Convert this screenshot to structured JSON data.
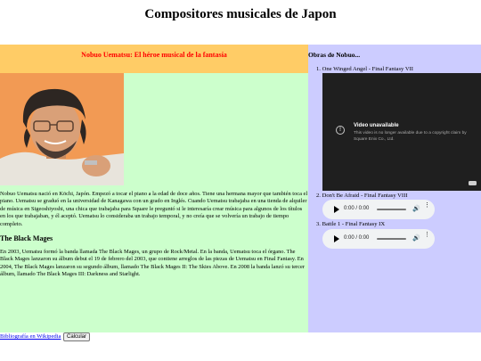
{
  "page": {
    "title": "Compositores musicales de Japon"
  },
  "main": {
    "banner_title": "Nobuo Uematsu: El héroe musical de la fantasía",
    "bio": "Nobuo Uematsu nació en Kōchi, Japón. Empezó a tocar el piano a la edad de doce años. Tiene una hermana mayor que también toca el piano. Uematsu se graduó en la universidad de Kanagawa con un grado en Inglés. Cuando Uematsu trabajaba en una tienda de alquiler de música en Sigeoshiyoshi, una chica que trabajaba para Square le preguntó si le interesaría crear música para algunos de los títulos en los que trabajaban, y él aceptó. Uematsu lo consideraba un trabajo temporal, y no creía que se volvería un trabajo de tiempo completo.",
    "section_heading": "The Black Mages",
    "bio2": "En 2003, Uematsu formó la banda llamada The Black Mages, un grupo de Rock/Metal. En la banda, Uematsu toca el órgano. The Black Mages lanzaron su álbum debut el 19 de febrero del 2003, que contiene arreglos de las piezas de Uematsu en Final Fantasy. En 2004, The Black Mages lanzaron su segundo álbum, llamado The Black Mages II: The Skies Above. En 2008 la banda lanzó su tercer álbum, llamado The Black Mages III: Darkness and Starlight."
  },
  "sidebar": {
    "title": "Obras de Nobuo...",
    "works": [
      {
        "label": "1. One Winged Angel - Final Fantasy VII"
      },
      {
        "label": "2. Don't Be Afraid - Final Fantasy VIII"
      },
      {
        "label": "3. Battle 1 - Final Fantasy IX"
      }
    ],
    "video": {
      "title": "Video unavailable",
      "message": "This video is no longer available due to a copyright claim by Square Enix Co., Ltd."
    },
    "audio_time": "0:00 / 0:00"
  },
  "footer": {
    "link_label": "Bibliografía en Wikipedia",
    "button_label": "Calcular"
  },
  "colors": {
    "banner_bg": "#ffcc66",
    "banner_text": "#ff0000",
    "main_bg": "#ccffcc",
    "sidebar_bg": "#ccccff"
  },
  "icons": {
    "video_warning": "warning-icon",
    "play": "play-icon",
    "volume": "volume-icon",
    "more": "more-icon"
  }
}
